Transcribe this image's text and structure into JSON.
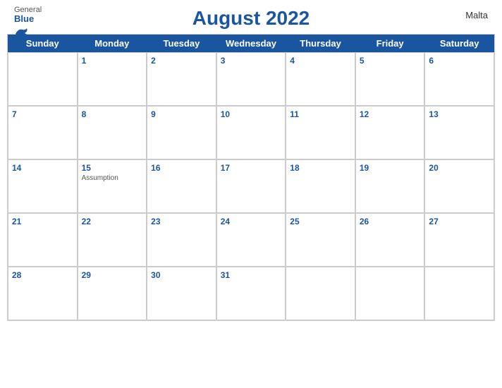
{
  "header": {
    "title": "August 2022",
    "country": "Malta",
    "logo": {
      "general": "General",
      "blue": "Blue"
    }
  },
  "days_of_week": [
    "Sunday",
    "Monday",
    "Tuesday",
    "Wednesday",
    "Thursday",
    "Friday",
    "Saturday"
  ],
  "weeks": [
    [
      {
        "date": "",
        "holiday": ""
      },
      {
        "date": "1",
        "holiday": ""
      },
      {
        "date": "2",
        "holiday": ""
      },
      {
        "date": "3",
        "holiday": ""
      },
      {
        "date": "4",
        "holiday": ""
      },
      {
        "date": "5",
        "holiday": ""
      },
      {
        "date": "6",
        "holiday": ""
      }
    ],
    [
      {
        "date": "7",
        "holiday": ""
      },
      {
        "date": "8",
        "holiday": ""
      },
      {
        "date": "9",
        "holiday": ""
      },
      {
        "date": "10",
        "holiday": ""
      },
      {
        "date": "11",
        "holiday": ""
      },
      {
        "date": "12",
        "holiday": ""
      },
      {
        "date": "13",
        "holiday": ""
      }
    ],
    [
      {
        "date": "14",
        "holiday": ""
      },
      {
        "date": "15",
        "holiday": "Assumption"
      },
      {
        "date": "16",
        "holiday": ""
      },
      {
        "date": "17",
        "holiday": ""
      },
      {
        "date": "18",
        "holiday": ""
      },
      {
        "date": "19",
        "holiday": ""
      },
      {
        "date": "20",
        "holiday": ""
      }
    ],
    [
      {
        "date": "21",
        "holiday": ""
      },
      {
        "date": "22",
        "holiday": ""
      },
      {
        "date": "23",
        "holiday": ""
      },
      {
        "date": "24",
        "holiday": ""
      },
      {
        "date": "25",
        "holiday": ""
      },
      {
        "date": "26",
        "holiday": ""
      },
      {
        "date": "27",
        "holiday": ""
      }
    ],
    [
      {
        "date": "28",
        "holiday": ""
      },
      {
        "date": "29",
        "holiday": ""
      },
      {
        "date": "30",
        "holiday": ""
      },
      {
        "date": "31",
        "holiday": ""
      },
      {
        "date": "",
        "holiday": ""
      },
      {
        "date": "",
        "holiday": ""
      },
      {
        "date": "",
        "holiday": ""
      }
    ]
  ],
  "colors": {
    "header_bg": "#1a56a0",
    "accent": "#1a56a0"
  }
}
